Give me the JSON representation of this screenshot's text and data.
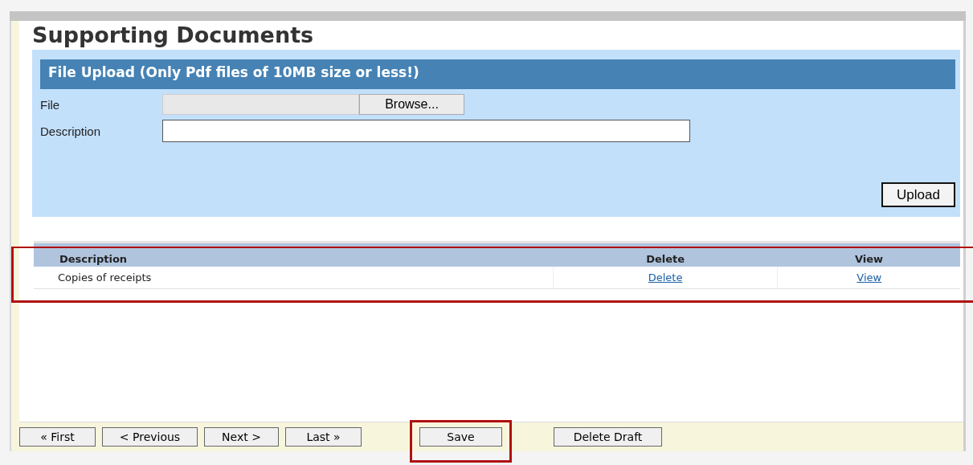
{
  "title": "Supporting Documents",
  "upload": {
    "heading": "File Upload (Only Pdf files of 10MB size or less!)",
    "file_label": "File",
    "browse_button": "Browse...",
    "description_label": "Description",
    "upload_button": "Upload"
  },
  "table": {
    "columns": [
      "Description",
      "Delete",
      "View"
    ],
    "rows": [
      {
        "description": "Copies of receipts",
        "delete": "Delete",
        "view": "View"
      }
    ]
  },
  "footer_buttons": [
    {
      "label": "« First",
      "highlighted": false
    },
    {
      "label": "< Previous",
      "highlighted": false
    },
    {
      "label": "Next >",
      "highlighted": false
    },
    {
      "label": "Last »",
      "highlighted": false
    },
    {
      "label": "Save",
      "highlighted": true
    },
    {
      "label": "Delete Draft",
      "highlighted": false
    }
  ]
}
